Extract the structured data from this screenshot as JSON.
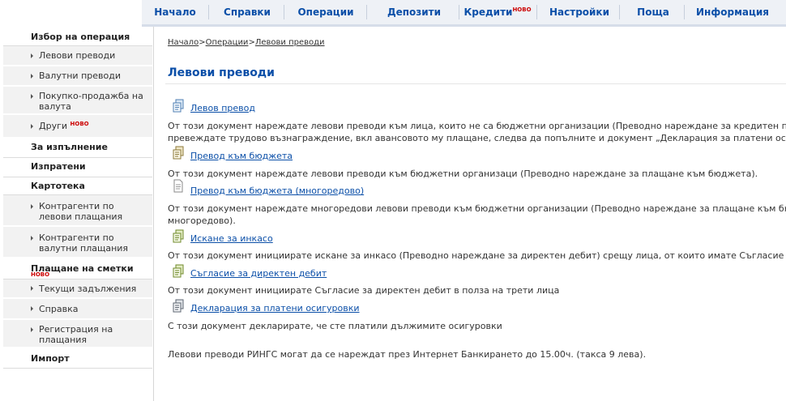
{
  "topnav": {
    "items": [
      {
        "label": "Начало"
      },
      {
        "label": "Справки"
      },
      {
        "label": "Операции"
      },
      {
        "label": "Депозити"
      },
      {
        "label": "Кредити",
        "badge": "НОВО"
      },
      {
        "label": "Настройки"
      },
      {
        "label": "Поща"
      },
      {
        "label": "Информация"
      }
    ]
  },
  "sidebar": {
    "operation_select": "Избор на операция",
    "lev_transfers": "Левови преводи",
    "currency_transfers": "Валутни преводи",
    "buy_sell_currency": "Покупко-продажба на валута",
    "others": "Други",
    "others_badge": "НОВО",
    "for_execution": "За изпълнение",
    "sent": "Изпратени",
    "card_index": "Картотека",
    "counterparties_lev": "Контрагенти по левови плащания",
    "counterparties_currency": "Контрагенти по валутни плащания",
    "bill_payment": "Плащане на сметки",
    "bill_payment_badge": "НОВО",
    "current_liabilities": "Текущи задължения",
    "reference": "Справка",
    "payment_registration": "Регистрация на плащания",
    "import": "Импорт"
  },
  "breadcrumb": {
    "home": "Начало",
    "sep1": ">",
    "operations": "Операции",
    "sep2": ">",
    "current": "Левови преводи"
  },
  "page_title": "Левови преводи",
  "documents": [
    {
      "link": "Левов превод",
      "desc_line1": "От този документ нареждате левови преводи към лица, които не са бюджетни организации (Преводно нареждане за кредитен превод). В случай, че",
      "desc_line2": "превеждате трудово възнаграждение, вкл авансовото му плащане, следва да попълните и документ „Декларация за платени осигуровки\"."
    },
    {
      "link": "Превод към бюджета",
      "desc_line1": "От този документ нареждате левови преводи към бюджетни организаци (Преводно нареждане за плащане към бюджета)."
    },
    {
      "link": "Превод към бюджета (многоредово)",
      "desc_line1": "От този документ нареждате многоредови левови преводи към бюджетни организации (Преводно нареждане за плащане към бюджета -",
      "desc_line2": "многоредово)."
    },
    {
      "link": "Искане за инкасо",
      "desc_line1": "От този документ инициирате искане за инкасо (Преводно нареждане за директен дебит) срещу лица, от които имате Съгласие за директен дебит."
    },
    {
      "link": "Съгласие за директен дебит",
      "desc_line1": "От този документ инициирате Съгласие за директен дебит в полза на трети лица"
    },
    {
      "link": "Декларация за платени осигуровки",
      "desc_line1": "С този документ декларирате, че сте платили дължимите осигуровки"
    }
  ],
  "footer_note": "Левови преводи РИНГС могат да се нареждат през Интернет Банкирането до 15.00ч. (такса 9 лева)."
}
